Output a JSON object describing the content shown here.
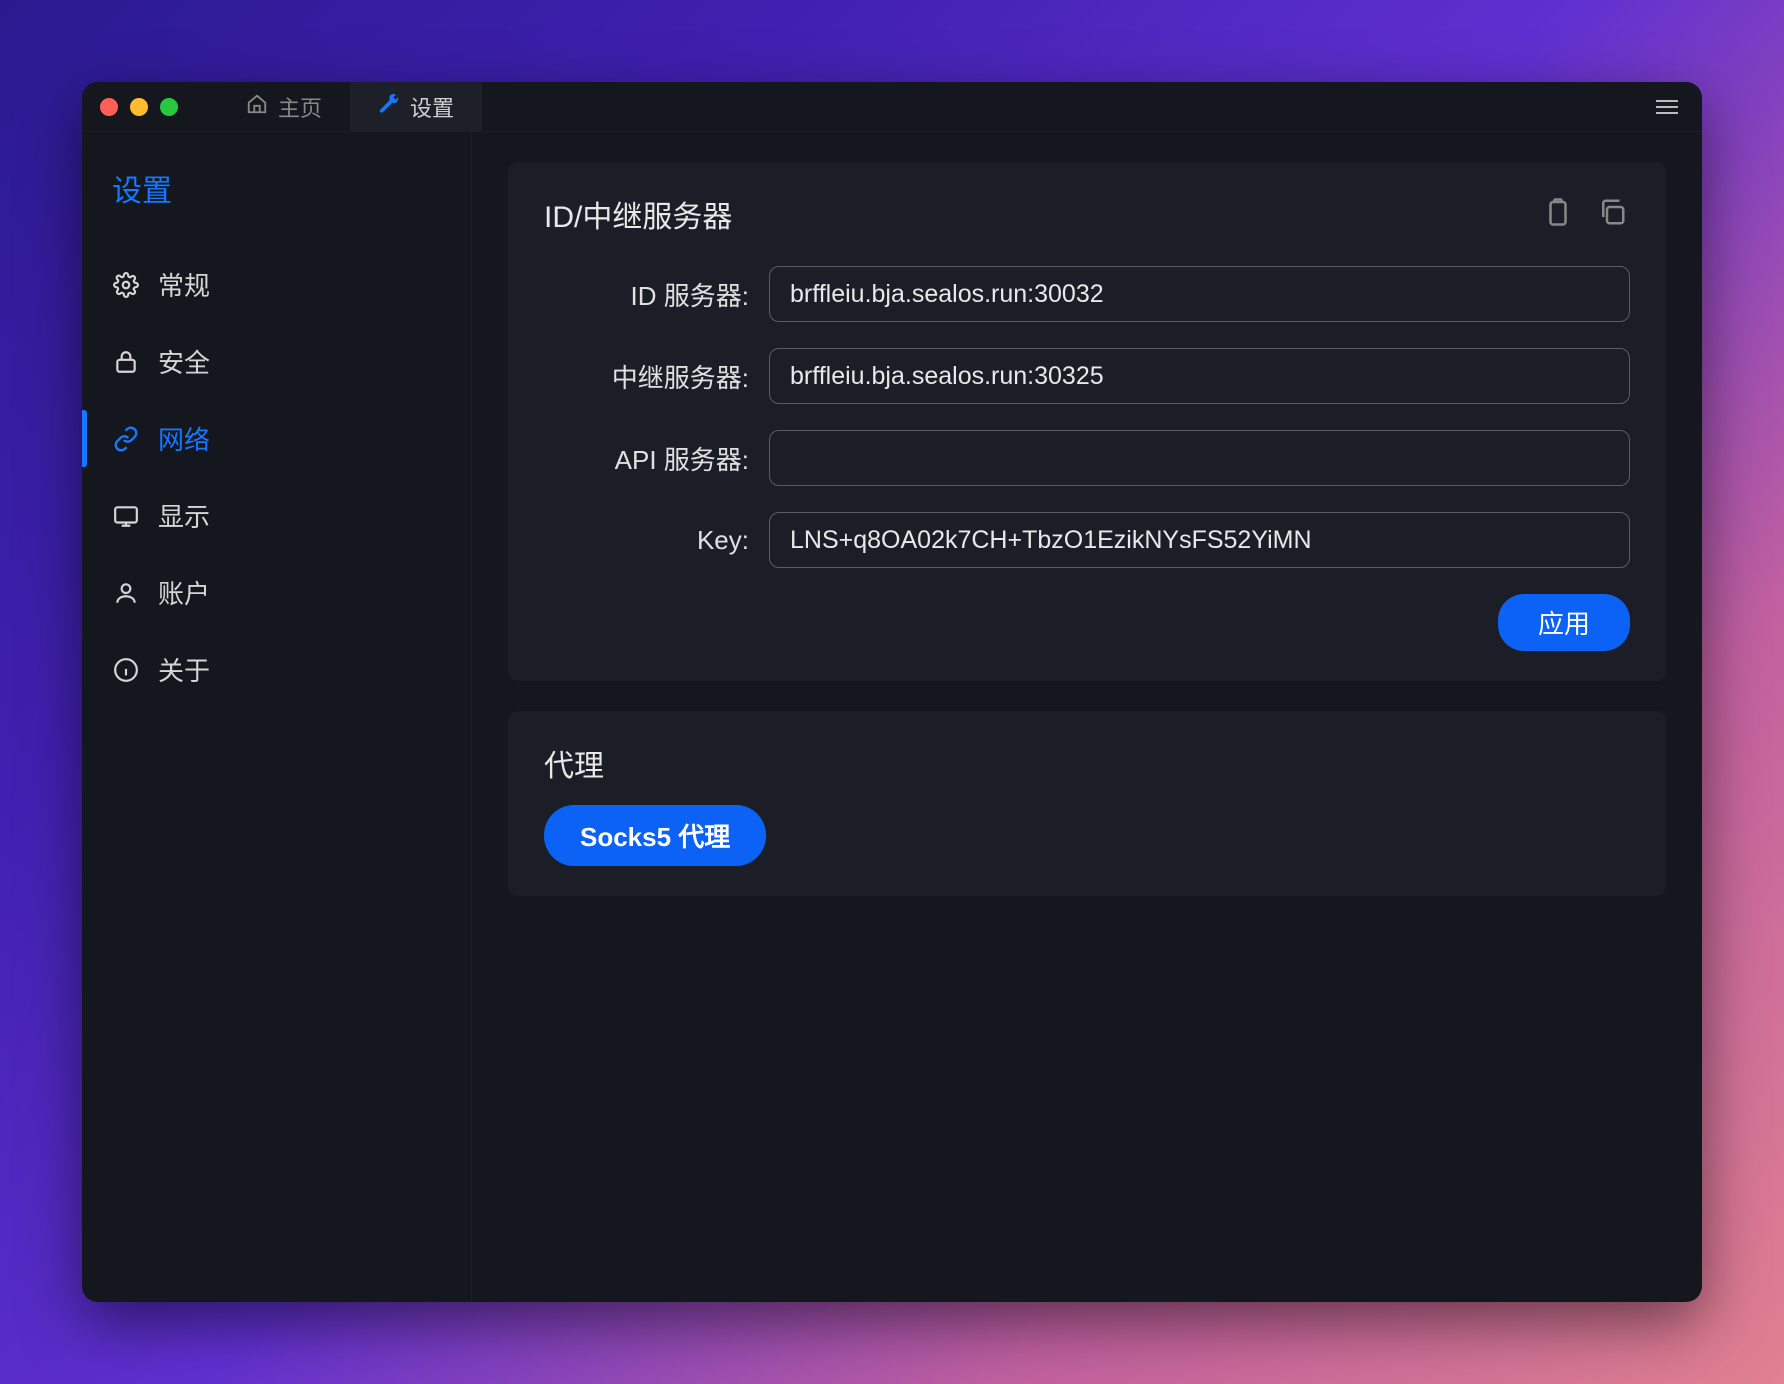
{
  "tabs": {
    "home": "主页",
    "settings": "设置"
  },
  "sidebar": {
    "title": "设置",
    "items": [
      {
        "id": "general",
        "label": "常规",
        "active": false
      },
      {
        "id": "security",
        "label": "安全",
        "active": false
      },
      {
        "id": "network",
        "label": "网络",
        "active": true
      },
      {
        "id": "display",
        "label": "显示",
        "active": false
      },
      {
        "id": "account",
        "label": "账户",
        "active": false
      },
      {
        "id": "about",
        "label": "关于",
        "active": false
      }
    ]
  },
  "relay": {
    "title": "ID/中继服务器",
    "fields": {
      "id_server": {
        "label": "ID 服务器:",
        "value": "brffleiu.bja.sealos.run:30032"
      },
      "relay_server": {
        "label": "中继服务器:",
        "value": "brffleiu.bja.sealos.run:30325"
      },
      "api_server": {
        "label": "API 服务器:",
        "value": ""
      },
      "key": {
        "label": "Key:",
        "value": "LNS+q8OA02k7CH+TbzO1EzikNYsFS52YiMN"
      }
    },
    "apply_label": "应用"
  },
  "proxy": {
    "title": "代理",
    "socks5_label": "Socks5 代理"
  }
}
